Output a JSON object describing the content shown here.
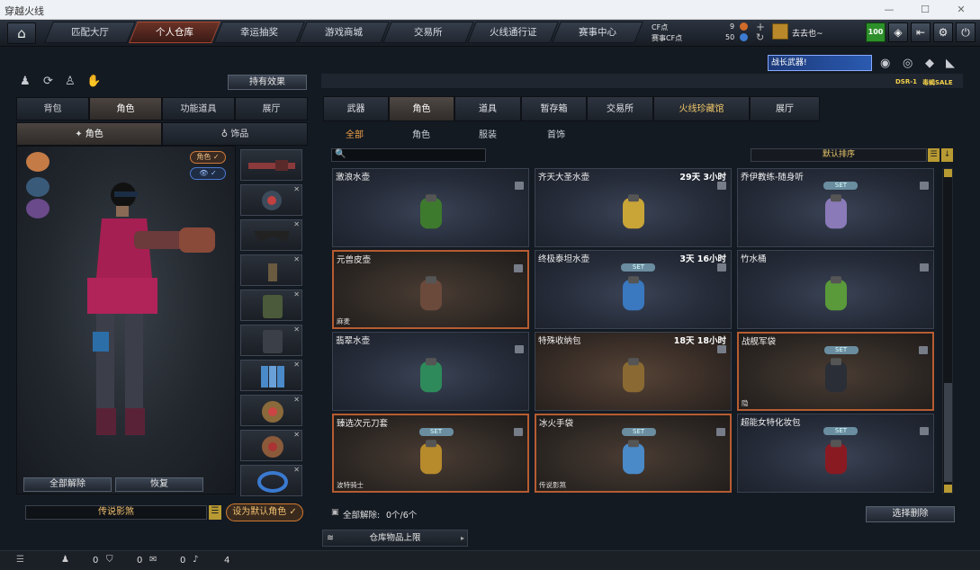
{
  "window": {
    "title": "穿越火线"
  },
  "nav": {
    "tabs": [
      "匹配大厅",
      "个人仓库",
      "幸运抽奖",
      "游戏商城",
      "交易所",
      "火线通行证",
      "赛事中心"
    ],
    "active": "个人仓库",
    "cf_label": "CF点",
    "cf_value": "9",
    "match_cf_label": "赛事CF点",
    "match_cf_value": "50",
    "username": "去去也~",
    "level": "100"
  },
  "left": {
    "effect_button": "持有效果",
    "tabs": [
      "背包",
      "角色",
      "功能道具",
      "展厅"
    ],
    "active_tab": "角色",
    "subtabs": [
      "角色",
      "饰品"
    ],
    "toggle_role_label": "角色",
    "check": "✓",
    "unequip_all": "全部解除",
    "restore": "恢复",
    "character_name": "传说影煞",
    "set_default": "设为默认角色"
  },
  "right": {
    "banner_text": "战长武器!",
    "weapon_caption_1": "DSR-1",
    "weapon_caption_2": "毒蝎SALE",
    "tabs": [
      "武器",
      "角色",
      "道具",
      "暂存箱",
      "交易所",
      "火线珍藏馆",
      "展厅"
    ],
    "active_tab": "角色",
    "subtabs": [
      "全部",
      "角色",
      "服装",
      "首饰"
    ],
    "active_subtab": "全部",
    "sort": "默认排序",
    "items": [
      {
        "name": "激浪水壶",
        "time": "",
        "set": "",
        "footer": "",
        "style": "normal",
        "color": "#3e7a2e"
      },
      {
        "name": "齐天大圣水壶",
        "time": "29天 3小时",
        "set": "",
        "footer": "",
        "style": "normal",
        "color": "#c9a437"
      },
      {
        "name": "乔伊教练-随身听",
        "time": "",
        "set": "SET",
        "footer": "",
        "style": "normal",
        "color": "#8a7ab8"
      },
      {
        "name": "元兽皮壶",
        "time": "",
        "set": "",
        "footer": "麻麦",
        "style": "orange",
        "color": "#6b4a3c"
      },
      {
        "name": "终极泰坦水壶",
        "time": "3天 16小时",
        "set": "SET",
        "footer": "",
        "style": "normal",
        "color": "#3a78c0"
      },
      {
        "name": "竹水桶",
        "time": "",
        "set": "",
        "footer": "",
        "style": "normal",
        "color": "#5a9a3a"
      },
      {
        "name": "翡翠水壶",
        "time": "",
        "set": "",
        "footer": "",
        "style": "normal",
        "color": "#2e8a5a"
      },
      {
        "name": "特殊收纳包",
        "time": "18天 18小时",
        "set": "",
        "footer": "",
        "style": "brown",
        "color": "#8a6a32"
      },
      {
        "name": "战舰军袋",
        "time": "",
        "set": "SET",
        "footer": "隐",
        "style": "orange",
        "color": "#2a2e36"
      },
      {
        "name": "臻选次元刀套",
        "time": "",
        "set": "SET",
        "footer": "波特骑士",
        "style": "orange",
        "color": "#b78a2c"
      },
      {
        "name": "冰火手袋",
        "time": "",
        "set": "SET",
        "footer": "传说影煞",
        "style": "orange",
        "color": "#4a8ac8"
      },
      {
        "name": "超能女特化妆包",
        "time": "",
        "set": "SET",
        "footer": "",
        "style": "normal",
        "color": "#8a1a22"
      }
    ],
    "unequip_label": "全部解除:",
    "unequip_count": "0个/6个",
    "select_remove": "选择删除",
    "capacity": "仓库物品上限"
  },
  "bottom": {
    "v1": "0",
    "v2": "0",
    "v3": "0",
    "v4": "4"
  }
}
